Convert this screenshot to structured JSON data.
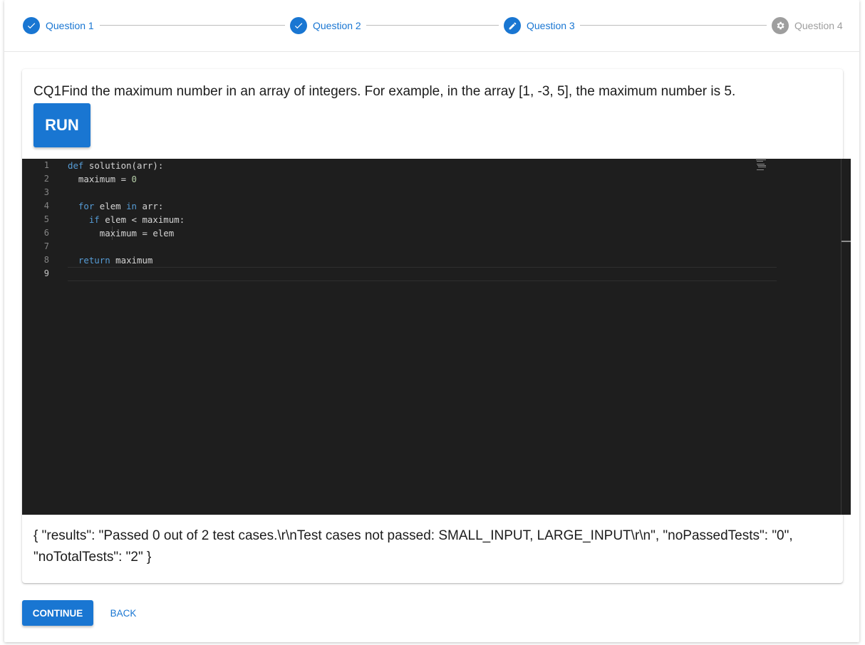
{
  "stepper": {
    "steps": [
      {
        "label": "Question 1",
        "state": "completed",
        "icon": "check-icon"
      },
      {
        "label": "Question 2",
        "state": "completed",
        "icon": "check-icon"
      },
      {
        "label": "Question 3",
        "state": "active",
        "icon": "pencil-icon"
      },
      {
        "label": "Question 4",
        "state": "pending",
        "icon": "gear-icon"
      }
    ]
  },
  "question": {
    "text": "CQ1Find the maximum number in an array of integers. For example, in the array [1, -3, 5], the maximum number is 5.",
    "run_label": "RUN"
  },
  "editor": {
    "lines": [
      "def solution(arr):",
      "  maximum = 0",
      "",
      "  for elem in arr:",
      "    if elem < maximum:",
      "      maximum = elem",
      "",
      "  return maximum",
      ""
    ],
    "line_numbers": [
      "1",
      "2",
      "3",
      "4",
      "5",
      "6",
      "7",
      "8",
      "9"
    ],
    "active_line": 9
  },
  "result": {
    "text": "{ \"results\": \"Passed 0 out of 2 test cases.\\r\\nTest cases not passed: SMALL_INPUT, LARGE_INPUT\\r\\n\", \"noPassedTests\": \"0\", \"noTotalTests\": \"2\" }"
  },
  "footer": {
    "continue_label": "CONTINUE",
    "back_label": "BACK"
  },
  "colors": {
    "primary": "#1976d2",
    "disabled": "#9e9e9e",
    "editor_bg": "#1e1e1e",
    "keyword": "#569cd6",
    "number": "#b5cea8"
  }
}
